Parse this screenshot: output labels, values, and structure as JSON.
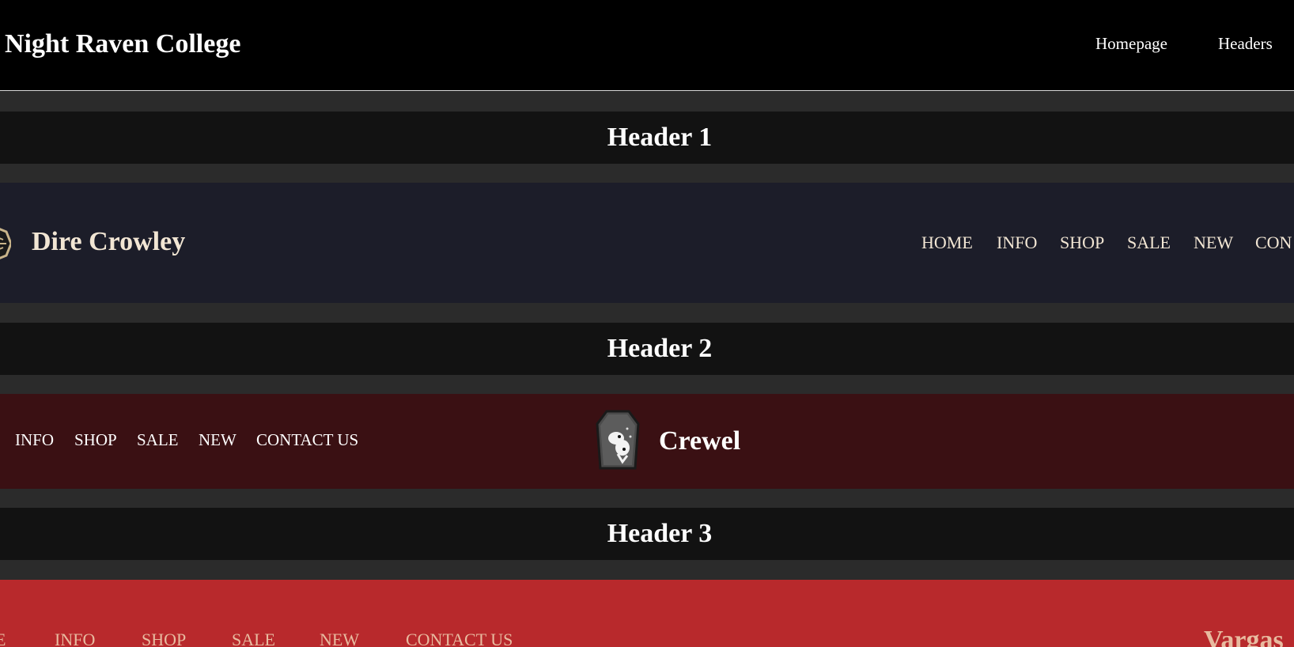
{
  "site": {
    "title": "Night Raven College",
    "nav": [
      "Homepage",
      "Headers"
    ]
  },
  "sections": [
    {
      "heading": "Header 1"
    },
    {
      "heading": "Header 2"
    },
    {
      "heading": "Header 3"
    }
  ],
  "header1": {
    "brand": "Dire Crowley",
    "logo_icon": "crow-mask-icon",
    "nav": [
      "HOME",
      "INFO",
      "SHOP",
      "SALE",
      "NEW",
      "CON"
    ]
  },
  "header2": {
    "brand": "Crewel",
    "logo_icon": "dalmatian-emblem-icon",
    "nav": [
      "INFO",
      "SHOP",
      "SALE",
      "NEW",
      "CONTACT US"
    ]
  },
  "header3": {
    "brand": "Vargas",
    "nav": [
      "E",
      "INFO",
      "SHOP",
      "SALE",
      "NEW",
      "CONTACT US"
    ]
  },
  "colors": {
    "page_bg": "#2b2b2b",
    "topbar_bg": "#000000",
    "section_heading_bg": "#121212",
    "header1_bg": "#1c1d29",
    "header1_text": "#f2e6d4",
    "header2_bg": "#3a1013",
    "header3_bg": "#b8292c",
    "header3_text": "#e8bba0"
  }
}
